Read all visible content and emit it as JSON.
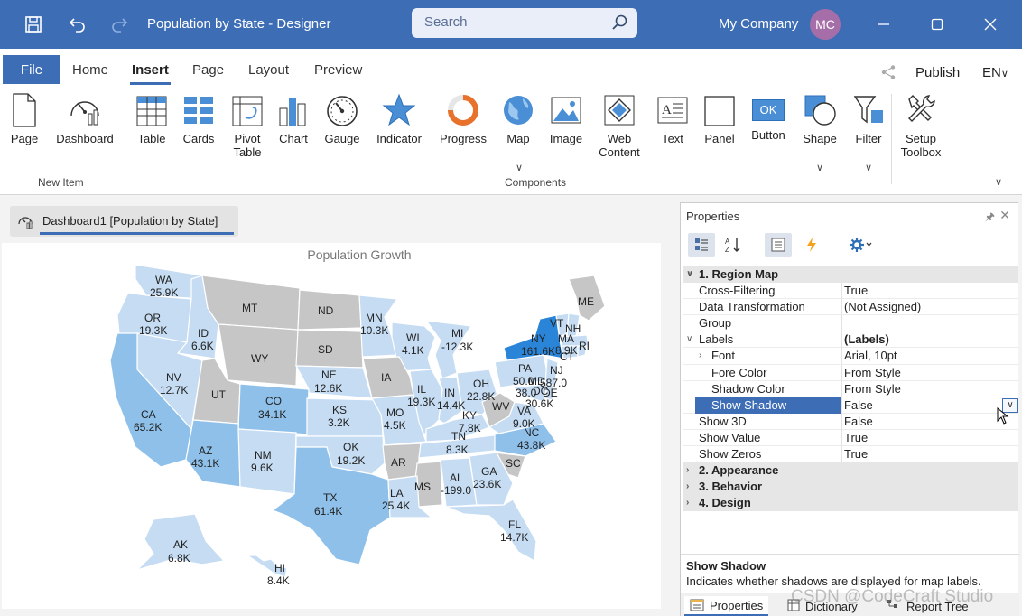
{
  "window": {
    "title": "Population by State - Designer",
    "search_placeholder": "Search",
    "company": "My Company",
    "avatar_initials": "MC"
  },
  "ribbon_tabs": {
    "file": "File",
    "tabs": [
      "Home",
      "Insert",
      "Page",
      "Layout",
      "Preview"
    ],
    "active": "Insert",
    "publish": "Publish",
    "language": "EN"
  },
  "ribbon": {
    "new_item": {
      "label": "New Item",
      "page": "Page",
      "dashboard": "Dashboard"
    },
    "components": {
      "label": "Components",
      "table": "Table",
      "cards": "Cards",
      "pivot1": "Pivot",
      "pivot2": "Table",
      "chart": "Chart",
      "gauge": "Gauge",
      "indicator": "Indicator",
      "progress": "Progress",
      "map": "Map",
      "image": "Image",
      "web1": "Web",
      "web2": "Content",
      "text": "Text",
      "panel": "Panel",
      "button": "Button",
      "button_face": "OK",
      "shape": "Shape",
      "filter": "Filter"
    },
    "setup1": "Setup",
    "setup2": "Toolbox"
  },
  "document_tab": "Dashboard1 [Population by State]",
  "map": {
    "title": "Population Growth",
    "colors": {
      "light": "#c5dcf3",
      "mid": "#8ec0ea",
      "dark": "#5da2e1",
      "darkest": "#2a85d8",
      "gray": "#c6c6c6"
    },
    "labels": {
      "WA": "WA",
      "WA_v": "25.9K",
      "OR": "OR",
      "OR_v": "19.3K",
      "ID": "ID",
      "ID_v": "6.6K",
      "MT": "MT",
      "ND": "ND",
      "MN": "MN",
      "MN_v": "10.3K",
      "WI": "WI",
      "WI_v": "4.1K",
      "MI": "MI",
      "MI_v": "-12.3K",
      "ME": "ME",
      "VT": "VT",
      "NH": "NH",
      "MA": "MA",
      "MA_v": "8.9K",
      "RI": "RI",
      "CT": "CT",
      "NY": "NY",
      "NY_v": "161.6K",
      "WY": "WY",
      "SD": "SD",
      "NV": "NV",
      "NV_v": "12.7K",
      "UT": "UT",
      "CO": "CO",
      "CO_v": "34.1K",
      "NE": "NE",
      "NE_v": "12.6K",
      "IA": "IA",
      "IL": "IL",
      "IL_v": "19.3K",
      "IN": "IN",
      "IN_v": "14.4K",
      "OH": "OH",
      "OH_v": "22.8K",
      "PA": "PA",
      "PA_v": "50.0",
      "NJ": "NJ",
      "NJ_v": "587.0",
      "MD": "MD",
      "MD_v": "38.0",
      "DE": "DE",
      "DE_v": "30.6K",
      "DC": "DC",
      "CA": "CA",
      "CA_v": "65.2K",
      "KS": "KS",
      "KS_v": "3.2K",
      "MO": "MO",
      "MO_v": "4.5K",
      "KY": "KY",
      "KY_v": "7.8K",
      "WV": "WV",
      "VA": "VA",
      "VA_v": "9.0K",
      "AZ": "AZ",
      "AZ_v": "43.1K",
      "NM": "NM",
      "NM_v": "9.6K",
      "OK": "OK",
      "OK_v": "19.2K",
      "AR": "AR",
      "TN": "TN",
      "TN_v": "8.3K",
      "NC": "NC",
      "NC_v": "43.8K",
      "SC": "SC",
      "MS": "MS",
      "AL": "AL",
      "AL_v": "-199.0",
      "GA": "GA",
      "GA_v": "23.6K",
      "TX": "TX",
      "TX_v": "61.4K",
      "LA": "LA",
      "LA_v": "25.4K",
      "FL": "FL",
      "FL_v": "14.7K",
      "AK": "AK",
      "AK_v": "6.8K",
      "HI": "HI",
      "HI_v": "8.4K"
    }
  },
  "properties": {
    "title": "Properties",
    "rows": [
      {
        "k": "1. Region  Map",
        "v": ""
      },
      {
        "k": "Cross-Filtering",
        "v": "True"
      },
      {
        "k": "Data Transformation",
        "v": "(Not Assigned)"
      },
      {
        "k": "Group",
        "v": ""
      },
      {
        "k": "Labels",
        "v": "(Labels)"
      },
      {
        "k": "Font",
        "v": "Arial, 10pt"
      },
      {
        "k": "Fore Color",
        "v": "From Style"
      },
      {
        "k": "Shadow Color",
        "v": "From Style"
      },
      {
        "k": "Show Shadow",
        "v": "False"
      },
      {
        "k": "Show 3D",
        "v": "False"
      },
      {
        "k": "Show Value",
        "v": "True"
      },
      {
        "k": "Show Zeros",
        "v": "True"
      },
      {
        "k": "2. Appearance",
        "v": ""
      },
      {
        "k": "3. Behavior",
        "v": ""
      },
      {
        "k": "4. Design",
        "v": ""
      }
    ],
    "desc_title": "Show Shadow",
    "desc_text": "Indicates whether shadows are displayed for map labels.",
    "tabs": [
      "Properties",
      "Dictionary",
      "Report Tree"
    ]
  },
  "watermark": "CSDN @CodeCraft Studio"
}
